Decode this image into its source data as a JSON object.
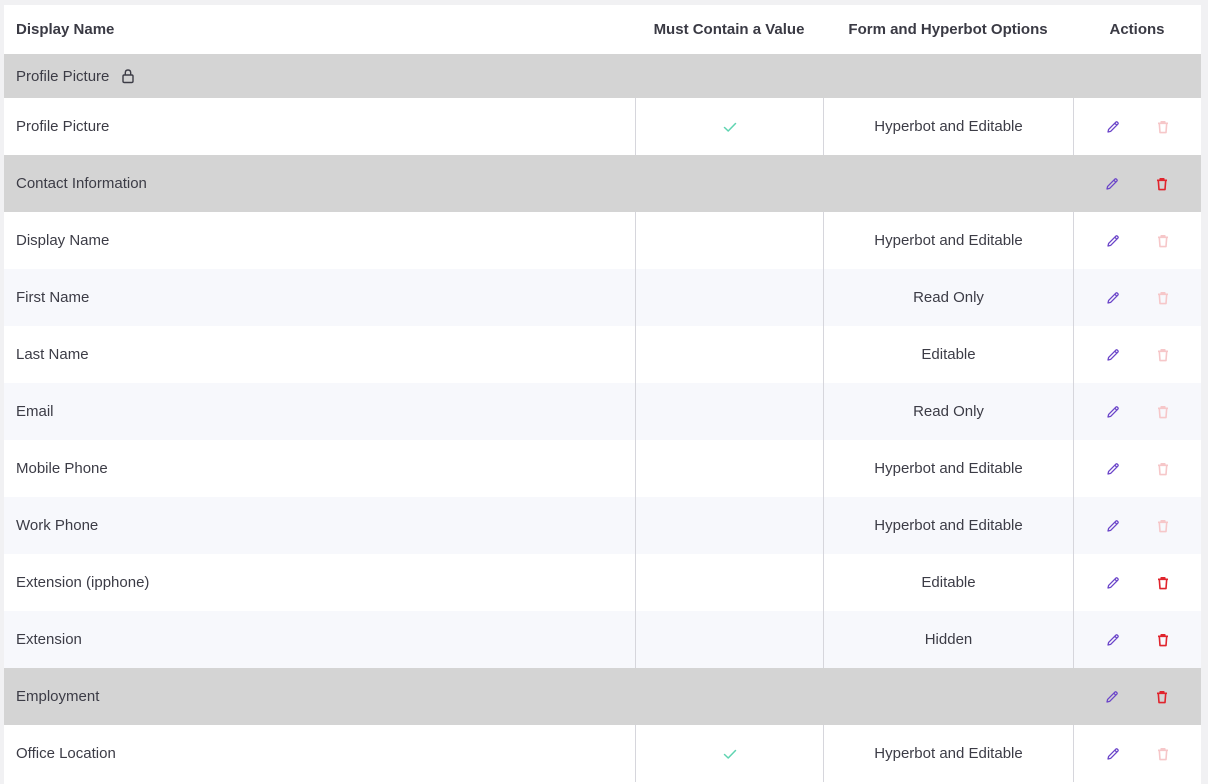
{
  "columns": {
    "display_name": "Display Name",
    "must_contain": "Must Contain a Value",
    "options": "Form and Hyperbot Options",
    "actions": "Actions"
  },
  "colors": {
    "edit_icon": "#6b45c9",
    "delete_active": "#e0242d",
    "delete_disabled": "#f6c7c9",
    "check": "#5fd4b1",
    "group_bg": "#d4d4d4"
  },
  "groups": {
    "profile_picture": {
      "label": "Profile Picture",
      "locked": true
    },
    "contact_information": {
      "label": "Contact Information"
    },
    "employment": {
      "label": "Employment"
    }
  },
  "rows": {
    "profile_picture": {
      "name": "Profile Picture",
      "required": true,
      "option": "Hyperbot and Editable",
      "delete_enabled": false
    },
    "display_name": {
      "name": "Display Name",
      "required": false,
      "option": "Hyperbot and Editable",
      "delete_enabled": false
    },
    "first_name": {
      "name": "First Name",
      "required": false,
      "option": "Read Only",
      "delete_enabled": false
    },
    "last_name": {
      "name": "Last Name",
      "required": false,
      "option": "Editable",
      "delete_enabled": false
    },
    "email": {
      "name": "Email",
      "required": false,
      "option": "Read Only",
      "delete_enabled": false
    },
    "mobile_phone": {
      "name": "Mobile Phone",
      "required": false,
      "option": "Hyperbot and Editable",
      "delete_enabled": false
    },
    "work_phone": {
      "name": "Work Phone",
      "required": false,
      "option": "Hyperbot and Editable",
      "delete_enabled": false
    },
    "extension_ipphone": {
      "name": "Extension (ipphone)",
      "required": false,
      "option": "Editable",
      "delete_enabled": true
    },
    "extension": {
      "name": "Extension",
      "required": false,
      "option": "Hidden",
      "delete_enabled": true
    },
    "office_location": {
      "name": "Office Location",
      "required": true,
      "option": "Hyperbot and Editable",
      "delete_enabled": false
    }
  }
}
